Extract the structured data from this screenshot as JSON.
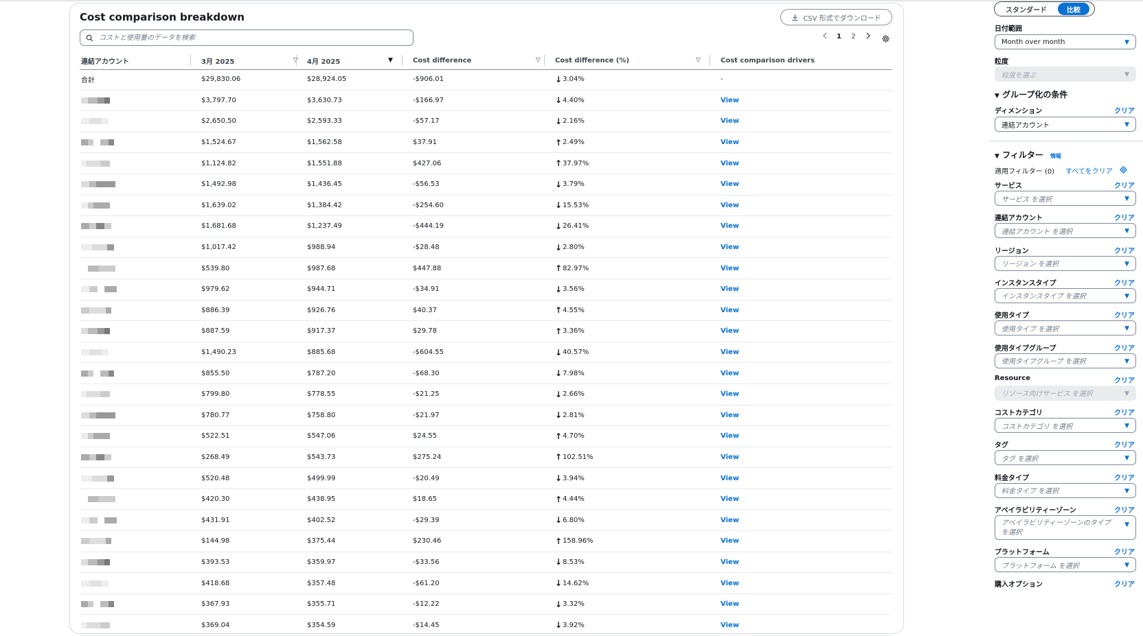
{
  "panel": {
    "title": "Cost comparison breakdown",
    "csv_button": "CSV 形式でダウンロード",
    "search_placeholder": "コストと使用量のデータを検索",
    "pages": [
      "1",
      "2"
    ]
  },
  "table": {
    "columns": [
      "連結アカウント",
      "3月 2025",
      "4月 2025",
      "Cost difference",
      "Cost difference (%)",
      "Cost comparison drivers"
    ],
    "total_row": {
      "account": "合計",
      "mar": "$29,830.06",
      "apr": "$28,924.05",
      "diff": "-$906.01",
      "pct": "3.04%",
      "driver": "-"
    },
    "view_label": "View",
    "rows": [
      {
        "mar": "$3,797.70",
        "apr": "$3,630.73",
        "diff": "-$166.97",
        "dir": "down",
        "pct": "4.40%"
      },
      {
        "mar": "$2,650.50",
        "apr": "$2,593.33",
        "diff": "-$57.17",
        "dir": "down",
        "pct": "2.16%"
      },
      {
        "mar": "$1,524.67",
        "apr": "$1,562.58",
        "diff": "$37.91",
        "dir": "up",
        "pct": "2.49%"
      },
      {
        "mar": "$1,124.82",
        "apr": "$1,551.88",
        "diff": "$427.06",
        "dir": "up",
        "pct": "37.97%"
      },
      {
        "mar": "$1,492.98",
        "apr": "$1,436.45",
        "diff": "-$56.53",
        "dir": "down",
        "pct": "3.79%"
      },
      {
        "mar": "$1,639.02",
        "apr": "$1,384.42",
        "diff": "-$254.60",
        "dir": "down",
        "pct": "15.53%"
      },
      {
        "mar": "$1,681.68",
        "apr": "$1,237.49",
        "diff": "-$444.19",
        "dir": "down",
        "pct": "26.41%"
      },
      {
        "mar": "$1,017.42",
        "apr": "$988.94",
        "diff": "-$28.48",
        "dir": "down",
        "pct": "2.80%"
      },
      {
        "mar": "$539.80",
        "apr": "$987.68",
        "diff": "$447.88",
        "dir": "up",
        "pct": "82.97%"
      },
      {
        "mar": "$979.62",
        "apr": "$944.71",
        "diff": "-$34.91",
        "dir": "down",
        "pct": "3.56%"
      },
      {
        "mar": "$886.39",
        "apr": "$926.76",
        "diff": "$40.37",
        "dir": "up",
        "pct": "4.55%"
      },
      {
        "mar": "$887.59",
        "apr": "$917.37",
        "diff": "$29.78",
        "dir": "up",
        "pct": "3.36%"
      },
      {
        "mar": "$1,490.23",
        "apr": "$885.68",
        "diff": "-$604.55",
        "dir": "down",
        "pct": "40.57%"
      },
      {
        "mar": "$855.50",
        "apr": "$787.20",
        "diff": "-$68.30",
        "dir": "down",
        "pct": "7.98%"
      },
      {
        "mar": "$799.80",
        "apr": "$778.55",
        "diff": "-$21.25",
        "dir": "down",
        "pct": "2.66%"
      },
      {
        "mar": "$780.77",
        "apr": "$758.80",
        "diff": "-$21.97",
        "dir": "down",
        "pct": "2.81%"
      },
      {
        "mar": "$522.51",
        "apr": "$547.06",
        "diff": "$24.55",
        "dir": "up",
        "pct": "4.70%"
      },
      {
        "mar": "$268.49",
        "apr": "$543.73",
        "diff": "$275.24",
        "dir": "up",
        "pct": "102.51%"
      },
      {
        "mar": "$520.48",
        "apr": "$499.99",
        "diff": "-$20.49",
        "dir": "down",
        "pct": "3.94%"
      },
      {
        "mar": "$420.30",
        "apr": "$438.95",
        "diff": "$18.65",
        "dir": "up",
        "pct": "4.44%"
      },
      {
        "mar": "$431.91",
        "apr": "$402.52",
        "diff": "-$29.39",
        "dir": "down",
        "pct": "6.80%"
      },
      {
        "mar": "$144.98",
        "apr": "$375.44",
        "diff": "$230.46",
        "dir": "up",
        "pct": "158.96%"
      },
      {
        "mar": "$393.53",
        "apr": "$359.97",
        "diff": "-$33.56",
        "dir": "down",
        "pct": "8.53%"
      },
      {
        "mar": "$418.68",
        "apr": "$357.48",
        "diff": "-$61.20",
        "dir": "down",
        "pct": "14.62%"
      },
      {
        "mar": "$367.93",
        "apr": "$355.71",
        "diff": "-$12.22",
        "dir": "down",
        "pct": "3.32%"
      },
      {
        "mar": "$369.04",
        "apr": "$354.59",
        "diff": "-$14.45",
        "dir": "down",
        "pct": "3.92%"
      }
    ]
  },
  "sidebar": {
    "toggle": {
      "standard": "スタンダード",
      "compare": "比較"
    },
    "date_range_label": "日付範囲",
    "date_range_value": "Month over month",
    "granularity_label": "粒度",
    "granularity_placeholder": "粒度を選ぶ",
    "group_section": "グループ化の条件",
    "dimension_label": "ディメンション",
    "dimension_value": "連結アカウント",
    "clear_label": "クリア",
    "filter_section": "フィルター",
    "info_label": "情報",
    "applied_filters": "適用フィルター (0)",
    "clear_all": "すべてをクリア",
    "filters": [
      {
        "label": "サービス",
        "placeholder": "サービス を選択"
      },
      {
        "label": "連結アカウント",
        "placeholder": "連結アカウント を選択"
      },
      {
        "label": "リージョン",
        "placeholder": "リージョン を選択"
      },
      {
        "label": "インスタンスタイプ",
        "placeholder": "インスタンスタイプ を選択"
      },
      {
        "label": "使用タイプ",
        "placeholder": "使用タイプ を選択"
      },
      {
        "label": "使用タイプグループ",
        "placeholder": "使用タイプグループ を選択"
      },
      {
        "label": "Resource",
        "placeholder": "リソース向けサービス を選択",
        "disabled": true
      },
      {
        "label": "コストカテゴリ",
        "placeholder": "コストカテゴリ を選択"
      },
      {
        "label": "タグ",
        "placeholder": "タグ を選択"
      },
      {
        "label": "料金タイプ",
        "placeholder": "料金タイプ を選択"
      },
      {
        "label": "アベイラビリティーゾーン",
        "placeholder": "アベイラビリティーゾーンのタイプ を選択",
        "tall": true
      },
      {
        "label": "プラットフォーム",
        "placeholder": "プラットフォーム を選択"
      },
      {
        "label": "購入オプション",
        "placeholder": ""
      }
    ]
  },
  "colors": {
    "link": "#0972d3",
    "text": "#16191f",
    "border": "#7d8998"
  }
}
